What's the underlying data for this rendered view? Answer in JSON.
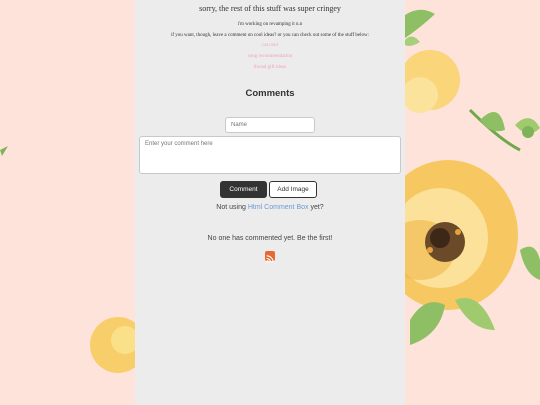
{
  "notice": {
    "header": "sorry, the rest of this stuff was super cringey",
    "line1": "i'm working on revamping it n.n",
    "line2": "if you want, though, leave a comment on cool ideas? or you can check out some of the stuff below:",
    "links": [
      "cat cool",
      "song recommendation",
      "thread gift ideas"
    ]
  },
  "comments": {
    "title": "Comments",
    "name_placeholder": "Name",
    "comment_placeholder": "Enter your comment here",
    "comment_button": "Comment",
    "add_image_button": "Add Image",
    "not_using_prefix": "Not using",
    "not_using_link": "Html Comment Box",
    "not_using_suffix": "yet?",
    "empty_message": "No one has commented yet. Be the first!",
    "rss_icon": "rss-feed-icon"
  },
  "colors": {
    "page_background": "#fde3da",
    "panel_background": "#ececec",
    "link_pink": "#f2a3b6",
    "link_blue": "#6b9ad6",
    "button_dark": "#333333",
    "rss_orange": "#e86a33"
  }
}
